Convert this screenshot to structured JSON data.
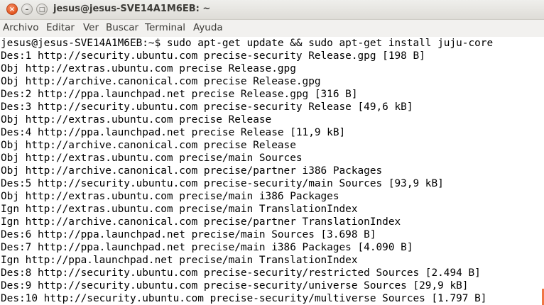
{
  "window": {
    "title": "jesus@jesus-SVE14A1M6EB: ~",
    "close_glyph": "×",
    "minimize_glyph": "–",
    "maximize_glyph": "□"
  },
  "menubar": {
    "items": [
      "Archivo",
      "Editar",
      "Ver",
      "Buscar",
      "Terminal",
      "Ayuda"
    ]
  },
  "terminal": {
    "lines": [
      "jesus@jesus-SVE14A1M6EB:~$ sudo apt-get update && sudo apt-get install juju-core",
      "Des:1 http://security.ubuntu.com precise-security Release.gpg [198 B]",
      "Obj http://extras.ubuntu.com precise Release.gpg",
      "Obj http://archive.canonical.com precise Release.gpg",
      "Des:2 http://ppa.launchpad.net precise Release.gpg [316 B]",
      "Des:3 http://security.ubuntu.com precise-security Release [49,6 kB]",
      "Obj http://extras.ubuntu.com precise Release",
      "Des:4 http://ppa.launchpad.net precise Release [11,9 kB]",
      "Obj http://archive.canonical.com precise Release",
      "Obj http://extras.ubuntu.com precise/main Sources",
      "Obj http://archive.canonical.com precise/partner i386 Packages",
      "Des:5 http://security.ubuntu.com precise-security/main Sources [93,9 kB]",
      "Obj http://extras.ubuntu.com precise/main i386 Packages",
      "Ign http://extras.ubuntu.com precise/main TranslationIndex",
      "Ign http://archive.canonical.com precise/partner TranslationIndex",
      "Des:6 http://ppa.launchpad.net precise/main Sources [3.698 B]",
      "Des:7 http://ppa.launchpad.net precise/main i386 Packages [4.090 B]",
      "Ign http://ppa.launchpad.net precise/main TranslationIndex",
      "Des:8 http://security.ubuntu.com precise-security/restricted Sources [2.494 B]",
      "Des:9 http://security.ubuntu.com precise-security/universe Sources [29,9 kB]",
      "Des:10 http://security.ubuntu.com precise-security/multiverse Sources [1.797 B]"
    ]
  }
}
